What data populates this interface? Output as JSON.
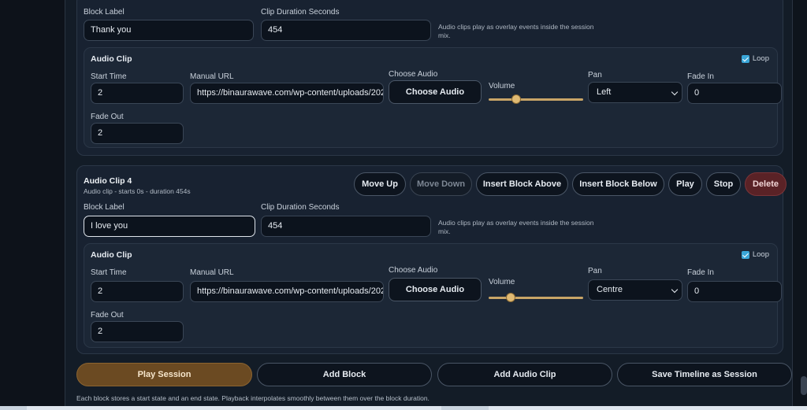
{
  "block3": {
    "block_label_label": "Block Label",
    "block_label_value": "Thank you",
    "duration_label": "Clip Duration Seconds",
    "duration_value": "454",
    "hint": "Audio clips play as overlay events inside the session mix.",
    "clip": {
      "title": "Audio Clip",
      "loop_label": "Loop",
      "loop_checked": true,
      "start_time_label": "Start Time",
      "start_time_value": "2",
      "manual_url_label": "Manual URL",
      "manual_url_value": "https://binaurawave.com/wp-content/uploads/202",
      "choose_audio_label": "Choose Audio",
      "choose_audio_button": "Choose Audio",
      "volume_label": "Volume",
      "volume_level": 0.27,
      "pan_label": "Pan",
      "pan_value": "Left",
      "fade_in_label": "Fade In",
      "fade_in_value": "0",
      "fade_out_label": "Fade Out",
      "fade_out_value": "2"
    }
  },
  "block4": {
    "title": "Audio Clip 4",
    "subtitle": "Audio clip - starts 0s - duration 454s",
    "buttons": {
      "move_up": "Move Up",
      "move_down": "Move Down",
      "insert_above": "Insert Block Above",
      "insert_below": "Insert Block Below",
      "play": "Play",
      "stop": "Stop",
      "delete": "Delete"
    },
    "block_label_label": "Block Label",
    "block_label_value": "I love you",
    "duration_label": "Clip Duration Seconds",
    "duration_value": "454",
    "hint": "Audio clips play as overlay events inside the session mix.",
    "clip": {
      "title": "Audio Clip",
      "loop_label": "Loop",
      "loop_checked": true,
      "start_time_label": "Start Time",
      "start_time_value": "2",
      "manual_url_label": "Manual URL",
      "manual_url_value": "https://binaurawave.com/wp-content/uploads/202",
      "choose_audio_label": "Choose Audio",
      "choose_audio_button": "Choose Audio",
      "volume_label": "Volume",
      "volume_level": 0.2,
      "pan_label": "Pan",
      "pan_value": "Centre",
      "fade_in_label": "Fade In",
      "fade_in_value": "0",
      "fade_out_label": "Fade Out",
      "fade_out_value": "2"
    }
  },
  "actions": {
    "play_session": "Play Session",
    "add_block": "Add Block",
    "add_audio_clip": "Add Audio Clip",
    "save_timeline": "Save Timeline as Session"
  },
  "footer_note": "Each block stores a start state and an end state. Playback interpolates smoothly between them over the block duration.",
  "colors": {
    "accent": "#e0ba73",
    "primary_button": "#6b4a22",
    "danger_button": "#5a2226",
    "checkbox": "#3aa6d8"
  }
}
